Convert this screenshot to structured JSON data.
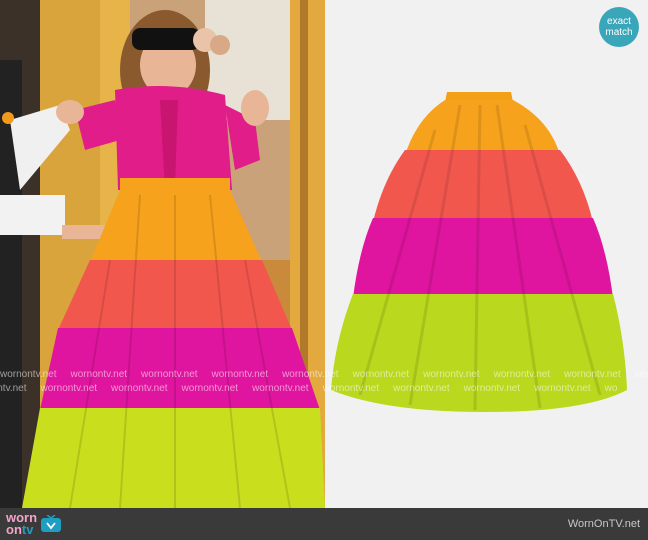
{
  "badge": {
    "line1": "exact",
    "line2": "match",
    "color": "#3aa6b9"
  },
  "watermark": {
    "text": "wornontv.net"
  },
  "footer": {
    "logo_worn": "worn",
    "logo_on": "on",
    "logo_tv": "tv",
    "site": "WornOnTV.net",
    "background": "#3a3a3a",
    "icon": "tv-icon"
  },
  "colors": {
    "skirt_orange": "#f6a21c",
    "skirt_coral": "#f2574e",
    "skirt_magenta": "#e0159f",
    "skirt_lime": "#b9d81e",
    "blouse_pink": "#e01d88"
  }
}
